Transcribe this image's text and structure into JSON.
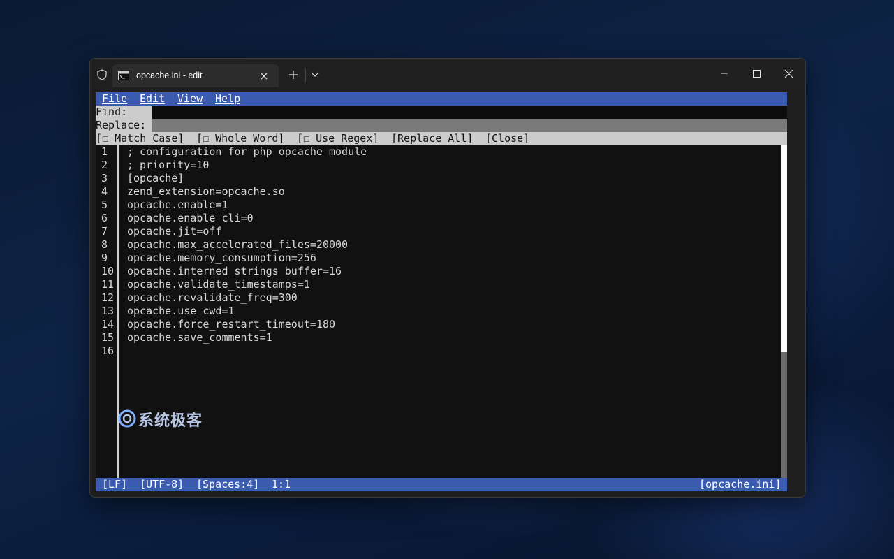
{
  "window": {
    "tab_title": "opcache.ini - edit"
  },
  "menu": {
    "file": "File",
    "edit": "Edit",
    "view": "View",
    "help": "Help"
  },
  "find_bar": {
    "find_label": "Find:",
    "find_value": "",
    "replace_label": "Replace:",
    "replace_value": ""
  },
  "options": {
    "match_case": "[☐ Match Case]",
    "whole_word": "[☐ Whole Word]",
    "use_regex": "[☐ Use Regex]",
    "replace_all": "[Replace All]",
    "close": "[Close]"
  },
  "editor": {
    "lines": [
      {
        "num": "1",
        "text": "; configuration for php opcache module"
      },
      {
        "num": "2",
        "text": "; priority=10"
      },
      {
        "num": "3",
        "text": "[opcache]"
      },
      {
        "num": "4",
        "text": "zend_extension=opcache.so"
      },
      {
        "num": "5",
        "text": "opcache.enable=1"
      },
      {
        "num": "6",
        "text": "opcache.enable_cli=0"
      },
      {
        "num": "7",
        "text": "opcache.jit=off"
      },
      {
        "num": "8",
        "text": "opcache.max_accelerated_files=20000"
      },
      {
        "num": "9",
        "text": "opcache.memory_consumption=256"
      },
      {
        "num": "10",
        "text": "opcache.interned_strings_buffer=16"
      },
      {
        "num": "11",
        "text": "opcache.validate_timestamps=1"
      },
      {
        "num": "12",
        "text": "opcache.revalidate_freq=300"
      },
      {
        "num": "13",
        "text": "opcache.use_cwd=1"
      },
      {
        "num": "14",
        "text": "opcache.force_restart_timeout=180"
      },
      {
        "num": "15",
        "text": "opcache.save_comments=1"
      },
      {
        "num": "16",
        "text": ""
      }
    ]
  },
  "status": {
    "line_ending": "[LF]",
    "encoding": "[UTF-8]",
    "indent": "[Spaces:4]",
    "cursor": "1:1",
    "filename": "[opcache.ini]"
  },
  "watermark": {
    "text": "系统极客"
  },
  "colors": {
    "menubar_bg": "#3a5bb0",
    "statusbar_bg": "#3a5bb0",
    "terminal_text": "#d8d8d8"
  }
}
